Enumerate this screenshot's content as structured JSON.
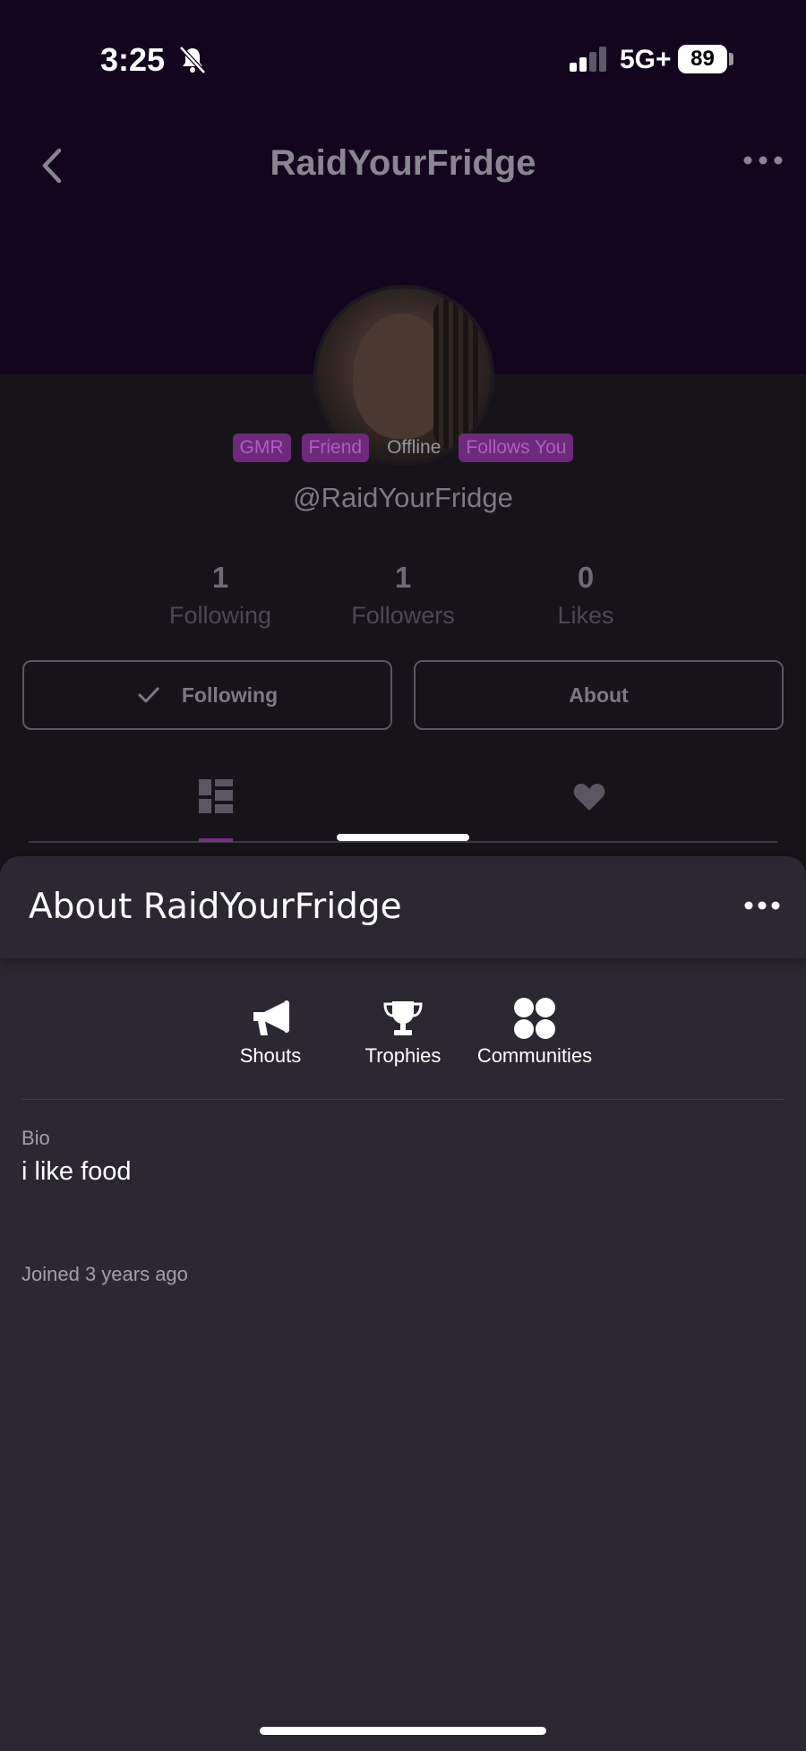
{
  "status_bar": {
    "time": "3:25",
    "network": "5G+",
    "battery": "89"
  },
  "header": {
    "title": "RaidYourFridge"
  },
  "profile": {
    "badges": [
      {
        "label": "GMR",
        "style": "pill"
      },
      {
        "label": "Friend",
        "style": "pill"
      },
      {
        "label": "Offline",
        "style": "plain"
      },
      {
        "label": "Follows You",
        "style": "pill"
      }
    ],
    "handle": "@RaidYourFridge",
    "stats": [
      {
        "value": "1",
        "label": "Following"
      },
      {
        "value": "1",
        "label": "Followers"
      },
      {
        "value": "0",
        "label": "Likes"
      }
    ],
    "following_button": "Following",
    "about_button": "About"
  },
  "sheet": {
    "title": "About RaidYourFridge",
    "tabs": [
      {
        "label": "Shouts",
        "icon": "megaphone-icon"
      },
      {
        "label": "Trophies",
        "icon": "trophy-icon"
      },
      {
        "label": "Communities",
        "icon": "communities-icon"
      }
    ],
    "bio_label": "Bio",
    "bio_text": "i like food",
    "joined": "Joined 3 years ago"
  },
  "colors": {
    "header_bg": "#14051f",
    "accent": "#7a2b88",
    "sheet_bg": "#2c2831",
    "page_bg": "#161419"
  }
}
